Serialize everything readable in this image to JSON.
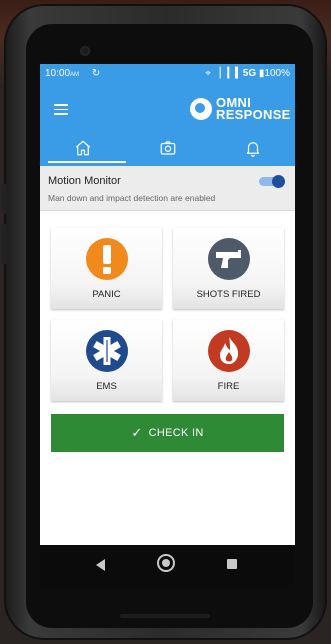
{
  "status_bar": {
    "time": "10:00",
    "ampm": "AM",
    "network": "5G",
    "battery": "100%"
  },
  "header": {
    "brand_line1": "OMNI",
    "brand_line2": "RESPONSE",
    "accent_color": "#3a9be6"
  },
  "tabs": [
    {
      "icon": "home-icon",
      "selected": true
    },
    {
      "icon": "camera-icon",
      "selected": false
    },
    {
      "icon": "bell-icon",
      "selected": false
    }
  ],
  "motion_monitor": {
    "title": "Motion Monitor",
    "subtitle": "Man down and impact detection are enabled",
    "enabled": true
  },
  "actions": [
    {
      "label": "PANIC",
      "icon": "exclamation-icon",
      "color": "#f08a1d"
    },
    {
      "label": "SHOTS FIRED",
      "icon": "pistol-icon",
      "color": "#4e5a6a"
    },
    {
      "label": "EMS",
      "icon": "star-of-life-icon",
      "color": "#1f4b8c"
    },
    {
      "label": "FIRE",
      "icon": "flame-icon",
      "color": "#c23a22"
    }
  ],
  "check_in": {
    "label": "CHECK IN",
    "color": "#2f8a36"
  }
}
